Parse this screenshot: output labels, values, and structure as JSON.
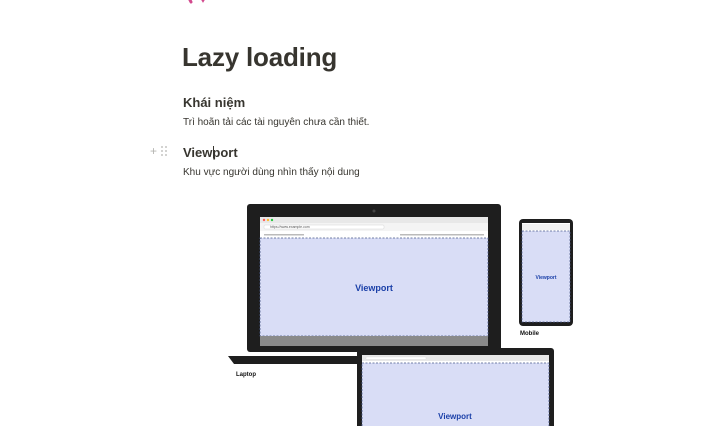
{
  "page": {
    "title": "Lazy loading",
    "icon": "page-emoji-icon"
  },
  "blocks": [
    {
      "type": "heading",
      "text": "Khái niệm"
    },
    {
      "type": "paragraph",
      "text": "Trì hoãn tải các tài nguyên chưa cần thiết."
    },
    {
      "type": "heading",
      "text": "Viewport"
    },
    {
      "type": "paragraph",
      "text": "Khu vực người dùng nhìn thấy nội dung"
    }
  ],
  "block_controls": {
    "add_icon": "plus-icon",
    "drag_icon": "drag-handle-icon"
  },
  "illustration": {
    "laptop_label": "Laptop",
    "mobile_label": "Mobile",
    "viewport_label": "Viewport",
    "url_text": "https://www.example.com",
    "viewport_color": "#d9ddf6",
    "viewport_text_color": "#1a3fa8"
  }
}
